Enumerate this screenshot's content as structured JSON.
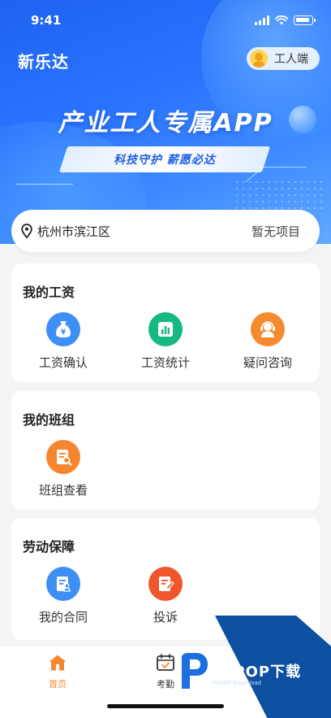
{
  "status_bar": {
    "time": "9:41"
  },
  "header": {
    "app_name": "新乐达",
    "role_label": "工人端"
  },
  "banner": {
    "slogan": "产业工人专属APP",
    "tagline": "科技守护 薪愿必达"
  },
  "location_bar": {
    "location": "杭州市滨江区",
    "project_status": "暂无项目"
  },
  "sections": {
    "wages": {
      "title": "我的工资",
      "items": [
        {
          "label": "工资确认",
          "icon": "money-bag-icon",
          "color": "#3d8ff5"
        },
        {
          "label": "工资统计",
          "icon": "bar-chart-icon",
          "color": "#16b981"
        },
        {
          "label": "疑问咨询",
          "icon": "headset-icon",
          "color": "#f58a2f"
        }
      ]
    },
    "team": {
      "title": "我的班组",
      "items": [
        {
          "label": "班组查看",
          "icon": "team-search-icon",
          "color": "#f5862f"
        }
      ]
    },
    "labor": {
      "title": "劳动保障",
      "items": [
        {
          "label": "我的合同",
          "icon": "contract-icon",
          "color": "#3d8ff5"
        },
        {
          "label": "投诉",
          "icon": "complaint-icon",
          "color": "#f0562b"
        }
      ]
    }
  },
  "tabbar": {
    "items": [
      {
        "label": "首页",
        "icon": "home-icon",
        "active": true
      },
      {
        "label": "考勤",
        "icon": "calendar-check-icon",
        "active": false
      }
    ],
    "active_color": "#f5862f"
  },
  "watermark": {
    "brand": "PCPOP下载",
    "sub": "PCPOP Download"
  }
}
